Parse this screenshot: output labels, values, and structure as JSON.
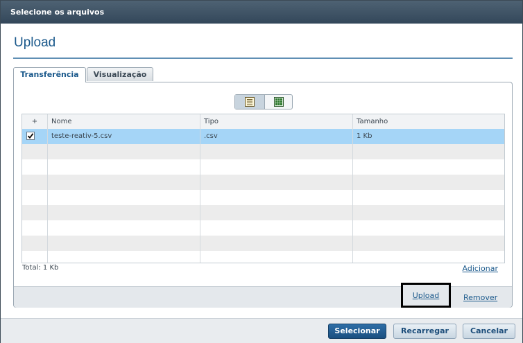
{
  "dialog": {
    "title": "Selecione os arquivos",
    "heading": "Upload"
  },
  "tabs": [
    {
      "label": "Transferência",
      "active": true
    },
    {
      "label": "Visualização",
      "active": false
    }
  ],
  "view_switch": {
    "list_icon": "list-view-icon",
    "grid_icon": "grid-view-icon",
    "selected": "list"
  },
  "table": {
    "columns": {
      "add": "+",
      "name": "Nome",
      "type": "Tipo",
      "size": "Tamanho"
    },
    "rows": [
      {
        "checked": true,
        "name": "teste-reativ-5.csv",
        "type": ".csv",
        "size": "1 Kb"
      }
    ],
    "empty_rows": 8
  },
  "footer": {
    "total": "Total: 1 Kb",
    "add_label": "Adicionar"
  },
  "actions": {
    "upload_label": "Upload",
    "remove_label": "Remover"
  },
  "buttons": {
    "select": "Selecionar",
    "reload": "Recarregar",
    "cancel": "Cancelar"
  },
  "colors": {
    "accent": "#1c5a8c",
    "selected_row": "#a5d5f7",
    "primary_button": "#1f5a8f"
  }
}
